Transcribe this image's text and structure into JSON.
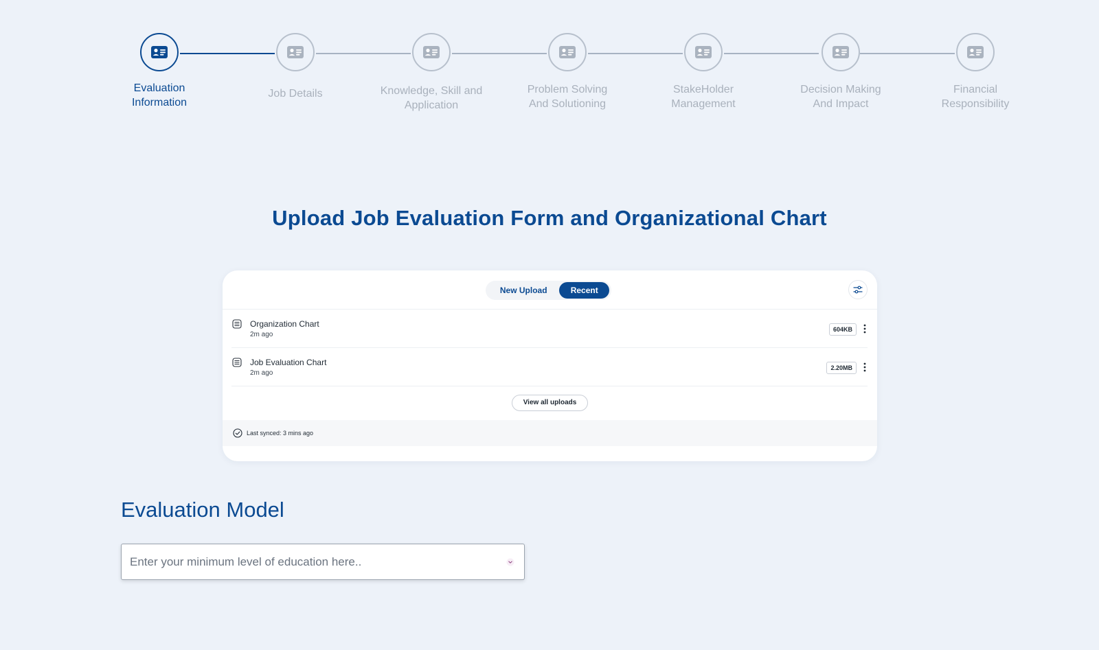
{
  "stepper": {
    "steps": [
      {
        "label": "Evaluation\nInformation",
        "state": "active"
      },
      {
        "label": "Job Details",
        "state": "pending"
      },
      {
        "label": "Knowledge, Skill and\nApplication",
        "state": "pending"
      },
      {
        "label": "Problem Solving\nAnd Solutioning",
        "state": "pending"
      },
      {
        "label": "StakeHolder\nManagement",
        "state": "pending"
      },
      {
        "label": "Decision Making\nAnd Impact",
        "state": "pending"
      },
      {
        "label": "Financial\nResponsibility",
        "state": "pending"
      }
    ],
    "icon": "contact-card-icon"
  },
  "upload": {
    "title": "Upload Job Evaluation Form and Organizational Chart",
    "tabs": {
      "new_upload": "New Upload",
      "recent": "Recent",
      "selected": "recent"
    },
    "files": [
      {
        "name": "Organization Chart",
        "time": "2m ago",
        "size": "604KB"
      },
      {
        "name": "Job Evaluation Chart",
        "time": "2m ago",
        "size": "2.20MB"
      }
    ],
    "view_all": "View all uploads",
    "sync_text": "Last synced: 3 mins ago"
  },
  "evaluation_model": {
    "title": "Evaluation Model",
    "placeholder": "Enter your minimum level of education here.."
  },
  "colors": {
    "primary": "#0b4a92",
    "background": "#edf2f9",
    "inactive": "#a9b1bc"
  }
}
